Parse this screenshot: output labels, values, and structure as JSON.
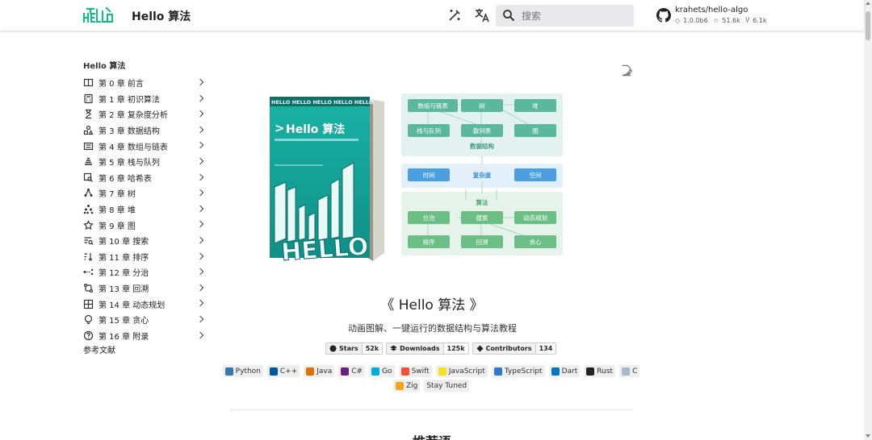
{
  "header": {
    "site_title": "Hello 算法",
    "search_placeholder": "搜索",
    "repo": {
      "name": "krahets/hello-algo",
      "version": "1.0.0b6",
      "stars": "51.6k",
      "forks": "6.1k"
    }
  },
  "sidebar": {
    "title": "Hello 算法",
    "items": [
      {
        "label": "第 0 章 前言",
        "icon": "book-open-icon"
      },
      {
        "label": "第 1 章 初识算法",
        "icon": "calculator-icon"
      },
      {
        "label": "第 2 章 复杂度分析",
        "icon": "hourglass-icon"
      },
      {
        "label": "第 3 章 数据结构",
        "icon": "shapes-icon"
      },
      {
        "label": "第 4 章 数组与链表",
        "icon": "list-box-icon"
      },
      {
        "label": "第 5 章 栈与队列",
        "icon": "stack-icon"
      },
      {
        "label": "第 6 章 哈希表",
        "icon": "table-search-icon"
      },
      {
        "label": "第 7 章 树",
        "icon": "tree-icon"
      },
      {
        "label": "第 8 章 堆",
        "icon": "heap-icon"
      },
      {
        "label": "第 9 章 图",
        "icon": "graph-icon"
      },
      {
        "label": "第 10 章 搜索",
        "icon": "text-search-icon"
      },
      {
        "label": "第 11 章 排序",
        "icon": "sort-icon"
      },
      {
        "label": "第 12 章 分治",
        "icon": "split-icon"
      },
      {
        "label": "第 13 章 回溯",
        "icon": "backtrack-icon"
      },
      {
        "label": "第 14 章 动态规划",
        "icon": "grid-icon"
      },
      {
        "label": "第 15 章 贪心",
        "icon": "bulb-icon"
      },
      {
        "label": "第 16 章 附录",
        "icon": "help-circle-icon"
      }
    ],
    "references": "参考文献"
  },
  "cover": {
    "brand": "HELLO",
    "title": "Hello 算法"
  },
  "diagram": {
    "data_structures_title": "数据结构",
    "ds_nodes": [
      "数组与链表",
      "树",
      "堆",
      "栈与队列",
      "散列表",
      "图"
    ],
    "complexity_title": "复杂度",
    "complexity_nodes": [
      "时间",
      "空间"
    ],
    "algorithms_title": "算法",
    "algo_nodes": [
      "分治",
      "搜索",
      "动态规划",
      "排序",
      "回溯",
      "贪心"
    ],
    "colors": {
      "teal": "#5cb89a",
      "blue": "#4a9fe0",
      "green_bg": "#e6f3ea",
      "blue_bg": "#e3f0fb",
      "teal_bg": "#e3f2ee"
    }
  },
  "book": {
    "title": "《 Hello 算法 》",
    "subtitle": "动画图解、一键运行的数据结构与算法教程"
  },
  "badges": [
    {
      "label": "Stars",
      "count": "52k",
      "icon": "github-icon"
    },
    {
      "label": "Downloads",
      "count": "125k",
      "icon": "download-icon"
    },
    {
      "label": "Contributors",
      "count": "134",
      "icon": "contributors-icon"
    }
  ],
  "languages_row1": [
    {
      "label": "Python",
      "color": "#3776ab"
    },
    {
      "label": "C++",
      "color": "#00599c"
    },
    {
      "label": "Java",
      "color": "#e76f00"
    },
    {
      "label": "C#",
      "color": "#68217a"
    },
    {
      "label": "Go",
      "color": "#00add8"
    },
    {
      "label": "Swift",
      "color": "#f05138"
    },
    {
      "label": "JavaScript",
      "color": "#f7df1e"
    },
    {
      "label": "TypeScript",
      "color": "#3178c6"
    },
    {
      "label": "Dart",
      "color": "#0175c2"
    },
    {
      "label": "Rust",
      "color": "#222222"
    },
    {
      "label": "C",
      "color": "#a8b9cc"
    }
  ],
  "languages_row2": [
    {
      "label": "Zig",
      "color": "#f7a41d"
    },
    {
      "label": "Stay Tuned",
      "color": ""
    }
  ],
  "next_heading": "推荐语"
}
